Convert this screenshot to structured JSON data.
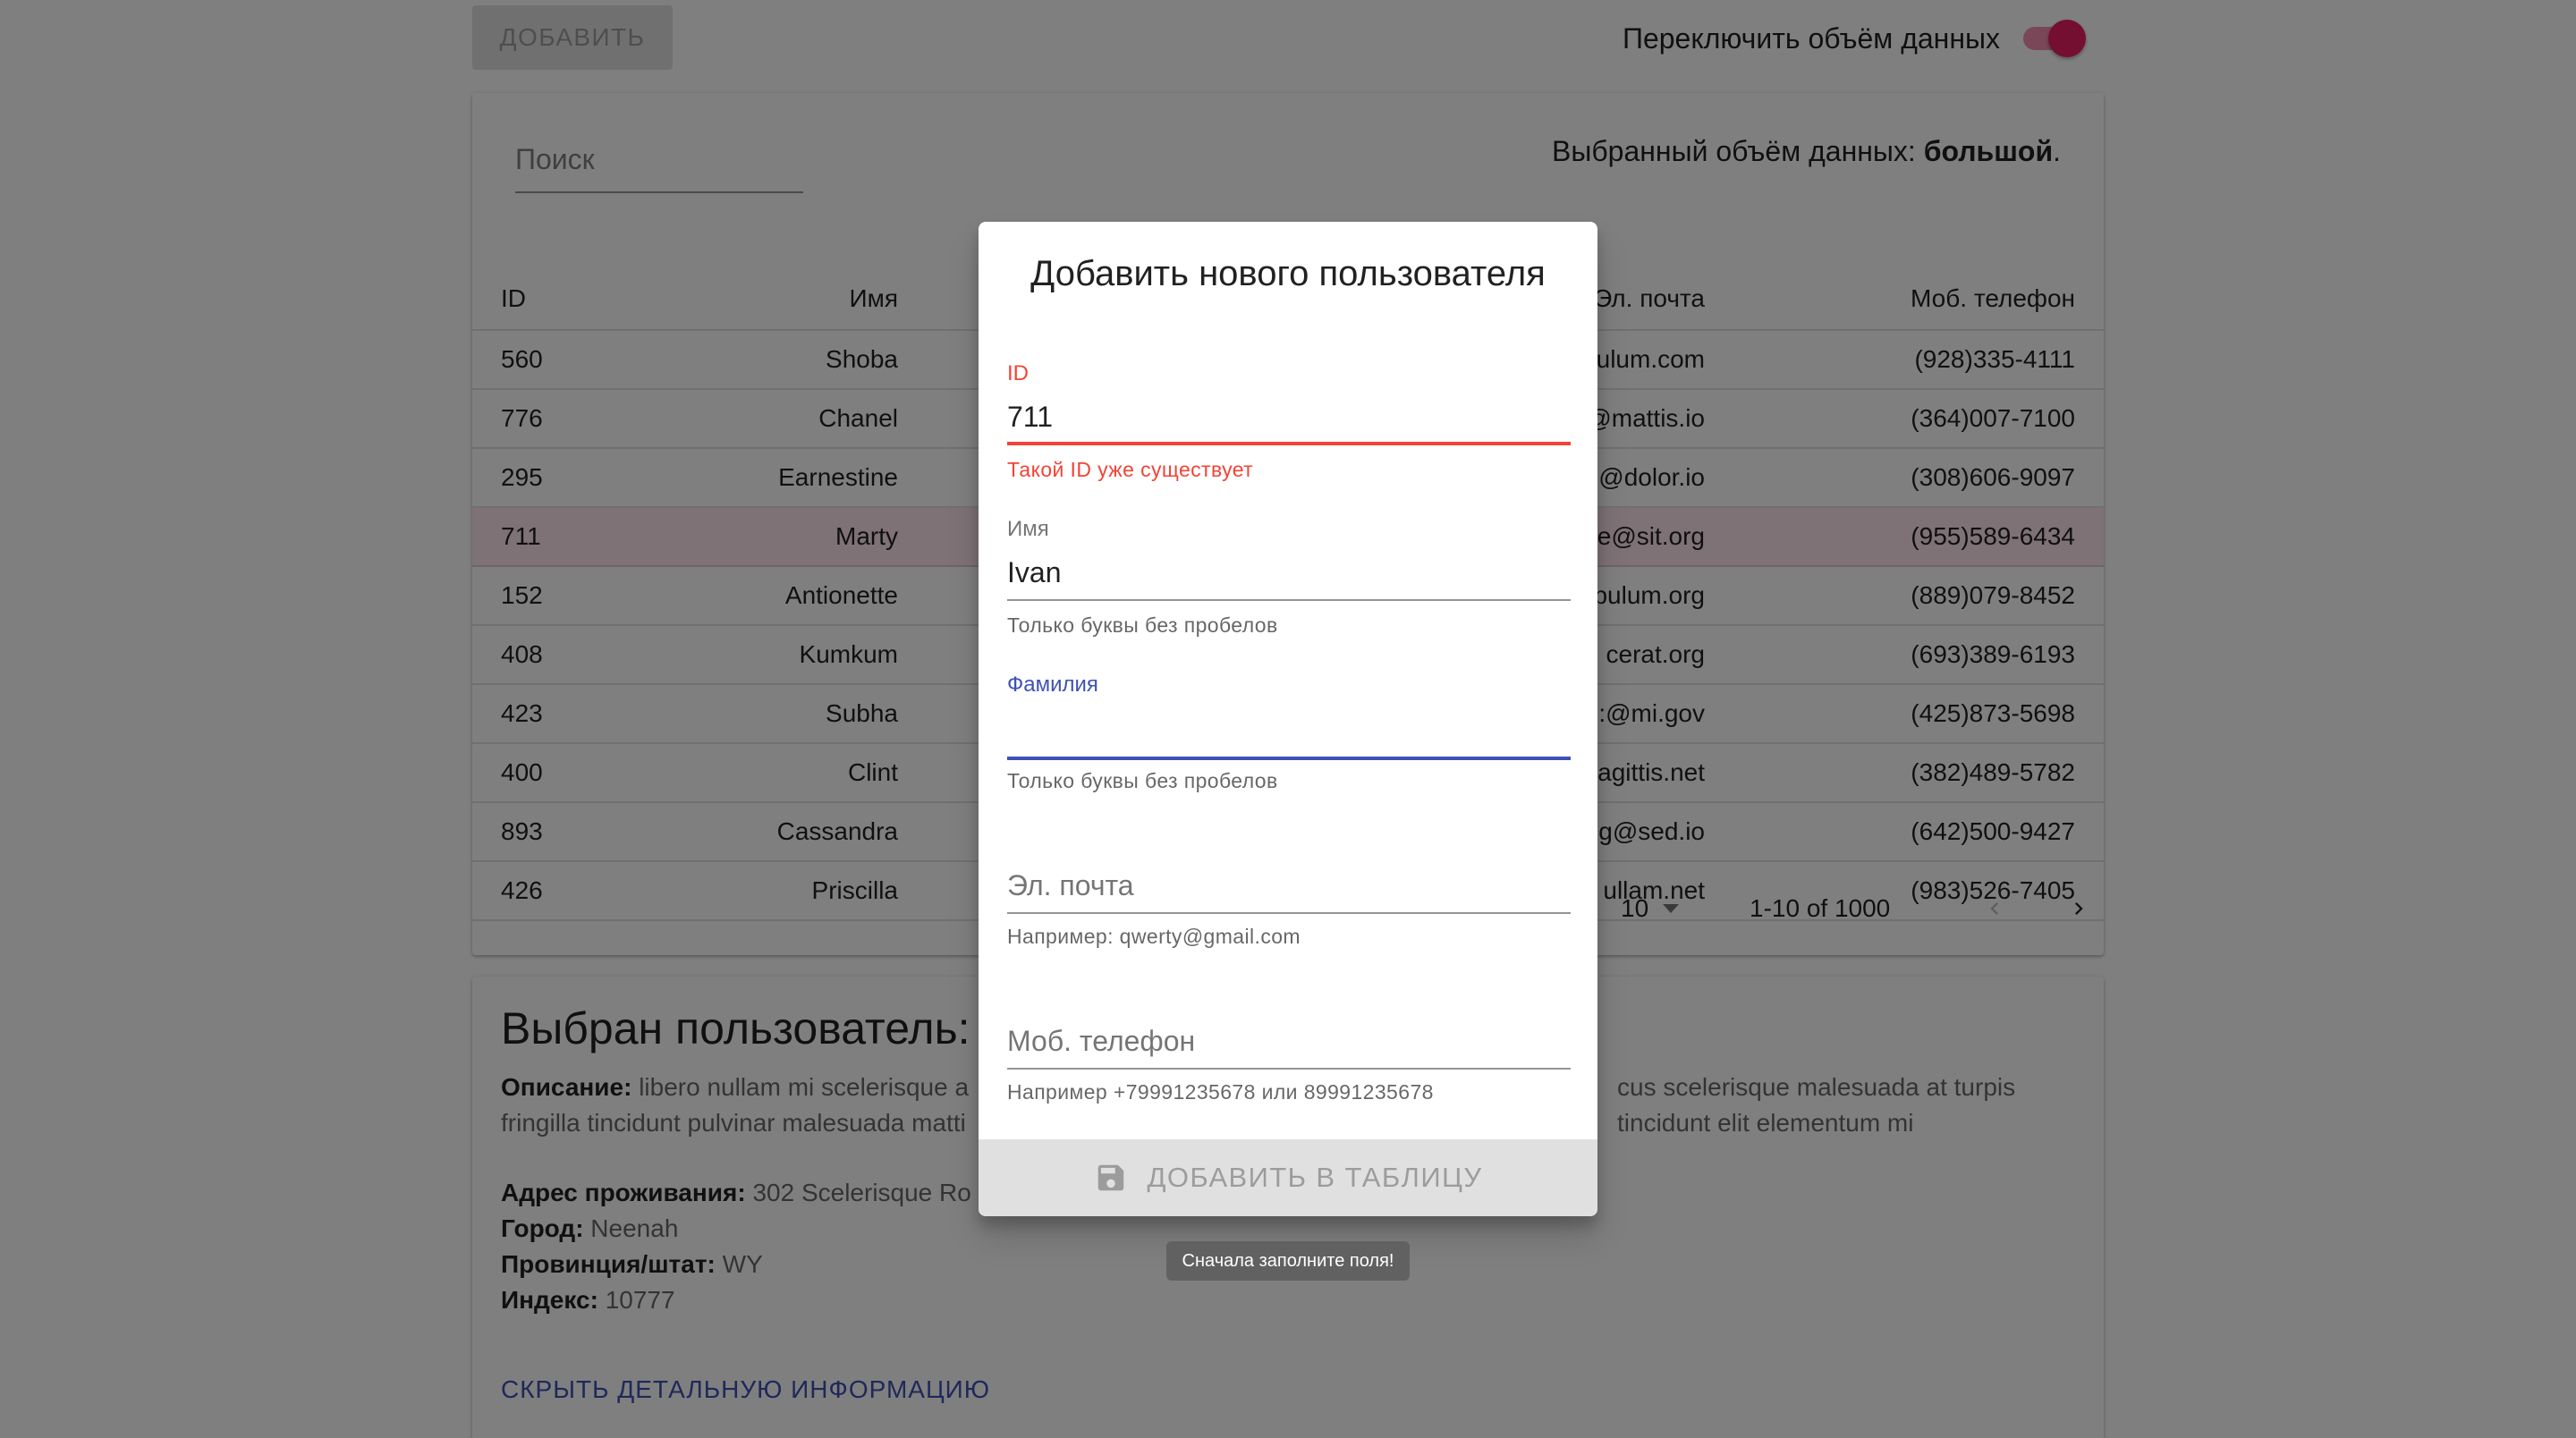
{
  "toolbar": {
    "add_label": "ДОБАВИТЬ",
    "toggle_label": "Переключить объём данных",
    "toggle_on": true
  },
  "table": {
    "search_placeholder": "Поиск",
    "volume_prefix": "Выбранный объём данных: ",
    "volume_value": "большой",
    "volume_suffix": ".",
    "headers": {
      "id": "ID",
      "name": "Имя",
      "email": "Эл. почта",
      "phone": "Моб. телефон"
    },
    "rows": [
      {
        "id": "560",
        "name": "Shoba",
        "email": "ulum.com",
        "phone": "(928)335-4111"
      },
      {
        "id": "776",
        "name": "Chanel",
        "email": "@mattis.io",
        "phone": "(364)007-7100"
      },
      {
        "id": "295",
        "name": "Earnestine",
        "email": "@dolor.io",
        "phone": "(308)606-9097"
      },
      {
        "id": "711",
        "name": "Marty",
        "email": "e@sit.org",
        "phone": "(955)589-6434"
      },
      {
        "id": "152",
        "name": "Antionette",
        "email": "pulum.org",
        "phone": "(889)079-8452"
      },
      {
        "id": "408",
        "name": "Kumkum",
        "email": "cerat.org",
        "phone": "(693)389-6193"
      },
      {
        "id": "423",
        "name": "Subha",
        "email": ":@mi.gov",
        "phone": "(425)873-5698"
      },
      {
        "id": "400",
        "name": "Clint",
        "email": "agittis.net",
        "phone": "(382)489-5782"
      },
      {
        "id": "893",
        "name": "Cassandra",
        "email": "g@sed.io",
        "phone": "(642)500-9427"
      },
      {
        "id": "426",
        "name": "Priscilla",
        "email": "ullam.net",
        "phone": "(983)526-7405"
      }
    ],
    "pagination": {
      "rows_per_page": "10",
      "range": "1-10 of 1000"
    }
  },
  "detail": {
    "title": "Выбран пользователь: I",
    "desc_label": "Описание:",
    "desc_text": " libero nullam mi scelerisque a",
    "desc_text_right": "cus scelerisque malesuada at turpis",
    "desc_line2_left": "fringilla tincidunt pulvinar malesuada matti",
    "desc_line2_right": "tincidunt elit elementum mi",
    "address_label": "Адрес проживания:",
    "address_value": " 302 Scelerisque Ro",
    "city_label": "Город:",
    "city_value": " Neenah",
    "state_label": "Провинция/штат:",
    "state_value": " WY",
    "zip_label": "Индекс:",
    "zip_value": " 10777",
    "hide_link": "СКРЫТЬ ДЕТАЛЬНУЮ ИНФОРМАЦИЮ"
  },
  "dialog": {
    "title": "Добавить нового пользователя",
    "id_label": "ID",
    "id_value": "711",
    "id_error": "Такой ID уже существует",
    "name_label": "Имя",
    "name_value": "Ivan",
    "name_help": "Только буквы без пробелов",
    "surname_label": "Фамилия",
    "surname_help": "Только буквы без пробелов",
    "email_placeholder": "Эл. почта",
    "email_help": "Например: qwerty@gmail.com",
    "phone_placeholder": "Моб. телефон",
    "phone_help": "Например +79991235678 или 89991235678",
    "submit_label": "ДОБАВИТЬ В ТАБЛИЦУ",
    "tooltip": "Сначала заполните поля!"
  },
  "colors": {
    "accent": "#e91e63",
    "primary": "#3f51b5",
    "error": "#f44336",
    "selected_row": "#fce4ec"
  },
  "icons": {
    "submit": "save-icon",
    "prev": "chevron-left-icon",
    "next": "chevron-right-icon",
    "rows_menu": "caret-down-icon"
  }
}
